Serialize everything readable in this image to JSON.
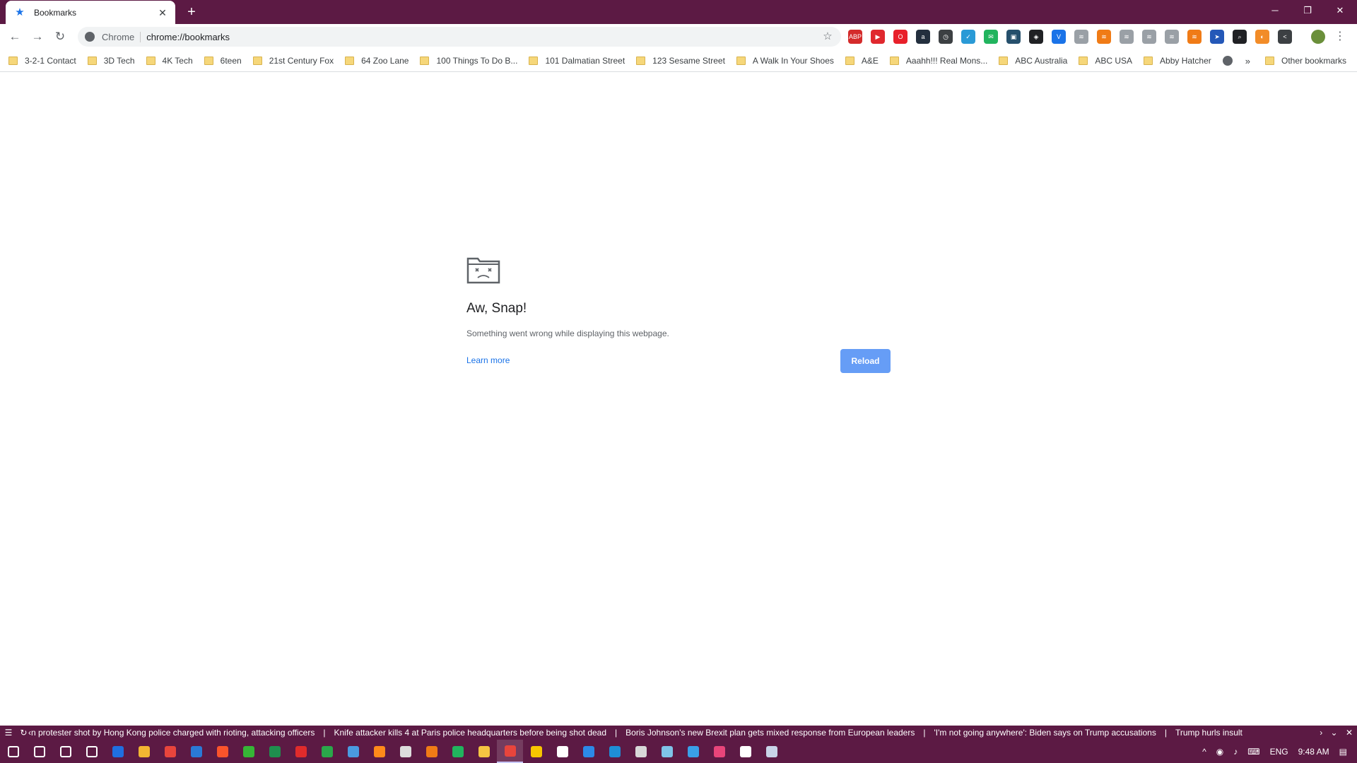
{
  "tab": {
    "title": "Bookmarks",
    "close": "✕",
    "new_tab": "+"
  },
  "window": {
    "minimize": "─",
    "restore": "❐",
    "close": "✕"
  },
  "toolbar": {
    "back": "←",
    "forward": "→",
    "reload": "↻",
    "site_chip": "Chrome",
    "url": "chrome://bookmarks",
    "star": "☆",
    "menu": "⋮"
  },
  "extensions": [
    {
      "name": "adblock-plus-icon",
      "label": "ABP",
      "color": "#d42b2b"
    },
    {
      "name": "record-icon",
      "label": "▶",
      "color": "#e0282e"
    },
    {
      "name": "opera-icon",
      "label": "O",
      "color": "#e8202a"
    },
    {
      "name": "amazon-icon",
      "label": "a",
      "color": "#232f3e"
    },
    {
      "name": "clock-icon",
      "label": "◷",
      "color": "#3c4043"
    },
    {
      "name": "shield-check-icon",
      "label": "✓",
      "color": "#2a9ad6"
    },
    {
      "name": "chat-icon",
      "label": "✉",
      "color": "#21b45e"
    },
    {
      "name": "photo-icon",
      "label": "▣",
      "color": "#26506c"
    },
    {
      "name": "privacy-shield-icon",
      "label": "◈",
      "color": "#202124"
    },
    {
      "name": "v-icon",
      "label": "V",
      "color": "#1a73e8"
    },
    {
      "name": "rss-gray-icon-1",
      "label": "≋",
      "color": "#9aa0a6"
    },
    {
      "name": "rss-orange-icon-1",
      "label": "≋",
      "color": "#f07b16"
    },
    {
      "name": "rss-gray-icon-2",
      "label": "≋",
      "color": "#9aa0a6"
    },
    {
      "name": "rss-gray-icon-3",
      "label": "≋",
      "color": "#9aa0a6"
    },
    {
      "name": "rss-gray-icon-4",
      "label": "≋",
      "color": "#9aa0a6"
    },
    {
      "name": "rss-orange-icon-2",
      "label": "≋",
      "color": "#f07b16"
    },
    {
      "name": "compass-icon",
      "label": "➤",
      "color": "#2458b8"
    },
    {
      "name": "search-icon",
      "label": "⌕",
      "color": "#202124"
    },
    {
      "name": "color-wheel-icon",
      "label": "◐",
      "color": "#f28c28"
    },
    {
      "name": "share-icon",
      "label": "<",
      "color": "#3c4043"
    }
  ],
  "bookmarks": [
    "3-2-1 Contact",
    "3D Tech",
    "4K Tech",
    "6teen",
    "21st Century Fox",
    "64 Zoo Lane",
    "100 Things To Do B...",
    "101 Dalmatian Street",
    "123 Sesame Street",
    "A Walk In Your Shoes",
    "A&E",
    "Aaahh!!! Real Mons...",
    "ABC Australia",
    "ABC USA",
    "Abby Hatcher"
  ],
  "bookmarks_overflow": "»",
  "other_bookmarks": "Other bookmarks",
  "error": {
    "title": "Aw, Snap!",
    "message": "Something went wrong while displaying this webpage.",
    "learn_more": "Learn more",
    "reload": "Reload"
  },
  "ticker": {
    "menu": "☰",
    "refresh": "↻",
    "prev": "‹",
    "items": [
      "n protester shot by Hong Kong police charged with rioting, attacking officers",
      "Knife attacker kills 4 at Paris police headquarters before being shot dead",
      "Boris Johnson's new Brexit plan gets mixed response from European leaders",
      "'I'm not going anywhere': Biden says on Trump accusations",
      "Trump hurls insult"
    ],
    "separator": "|",
    "next": "›",
    "collapse": "⌄",
    "close": "✕"
  },
  "taskbar": {
    "apps": [
      {
        "name": "windows-start-icon",
        "color": "#ffffff"
      },
      {
        "name": "search-icon",
        "color": "#ffffff"
      },
      {
        "name": "cortana-icon",
        "color": "#ffffff"
      },
      {
        "name": "task-view-icon",
        "color": "#ffffff"
      },
      {
        "name": "defender-icon",
        "color": "#1f6fe0"
      },
      {
        "name": "chrome-canary-icon",
        "color": "#f2b632"
      },
      {
        "name": "chrome-icon",
        "color": "#e8453c"
      },
      {
        "name": "clock-app-icon",
        "color": "#2a7ad6"
      },
      {
        "name": "brave-icon",
        "color": "#fb542b"
      },
      {
        "name": "camtasia-icon",
        "color": "#36b536"
      },
      {
        "name": "capture-icon",
        "color": "#1f8f4e"
      },
      {
        "name": "c-red-icon",
        "color": "#e02b2b"
      },
      {
        "name": "c-green-icon",
        "color": "#2aa84a"
      },
      {
        "name": "globe-app-icon",
        "color": "#4a9be0"
      },
      {
        "name": "firefox-icon",
        "color": "#ff8a1a"
      },
      {
        "name": "record-app-icon",
        "color": "#dddddd"
      },
      {
        "name": "rss-app-icon",
        "color": "#f07b16"
      },
      {
        "name": "chat-app-icon",
        "color": "#21b45e"
      },
      {
        "name": "file-explorer-icon",
        "color": "#f4c542"
      },
      {
        "name": "chrome-active-icon",
        "color": "#e8453c"
      },
      {
        "name": "yellow-app-icon",
        "color": "#f7c600"
      },
      {
        "name": "mail-icon",
        "color": "#ffffff"
      },
      {
        "name": "messenger-icon",
        "color": "#2c8ae8"
      },
      {
        "name": "edge-icon",
        "color": "#1e8ed6"
      },
      {
        "name": "store-icon",
        "color": "#d8d8d8"
      },
      {
        "name": "notepad-icon",
        "color": "#7fc4e8"
      },
      {
        "name": "network-app-icon",
        "color": "#3aa0e8"
      },
      {
        "name": "maps-icon",
        "color": "#e8457a"
      },
      {
        "name": "photos-icon",
        "color": "#ffffff"
      },
      {
        "name": "calculator-icon",
        "color": "#c9d4e8"
      }
    ],
    "tray": {
      "chevron": "^",
      "network": "◉",
      "volume": "♪",
      "keyboard": "⌨",
      "language": "ENG",
      "time": "9:48 AM",
      "notifications": "▤"
    }
  },
  "colors": {
    "chrome_frame": "#5c1a44",
    "reload_button": "#669df6",
    "link": "#1a73e8"
  }
}
